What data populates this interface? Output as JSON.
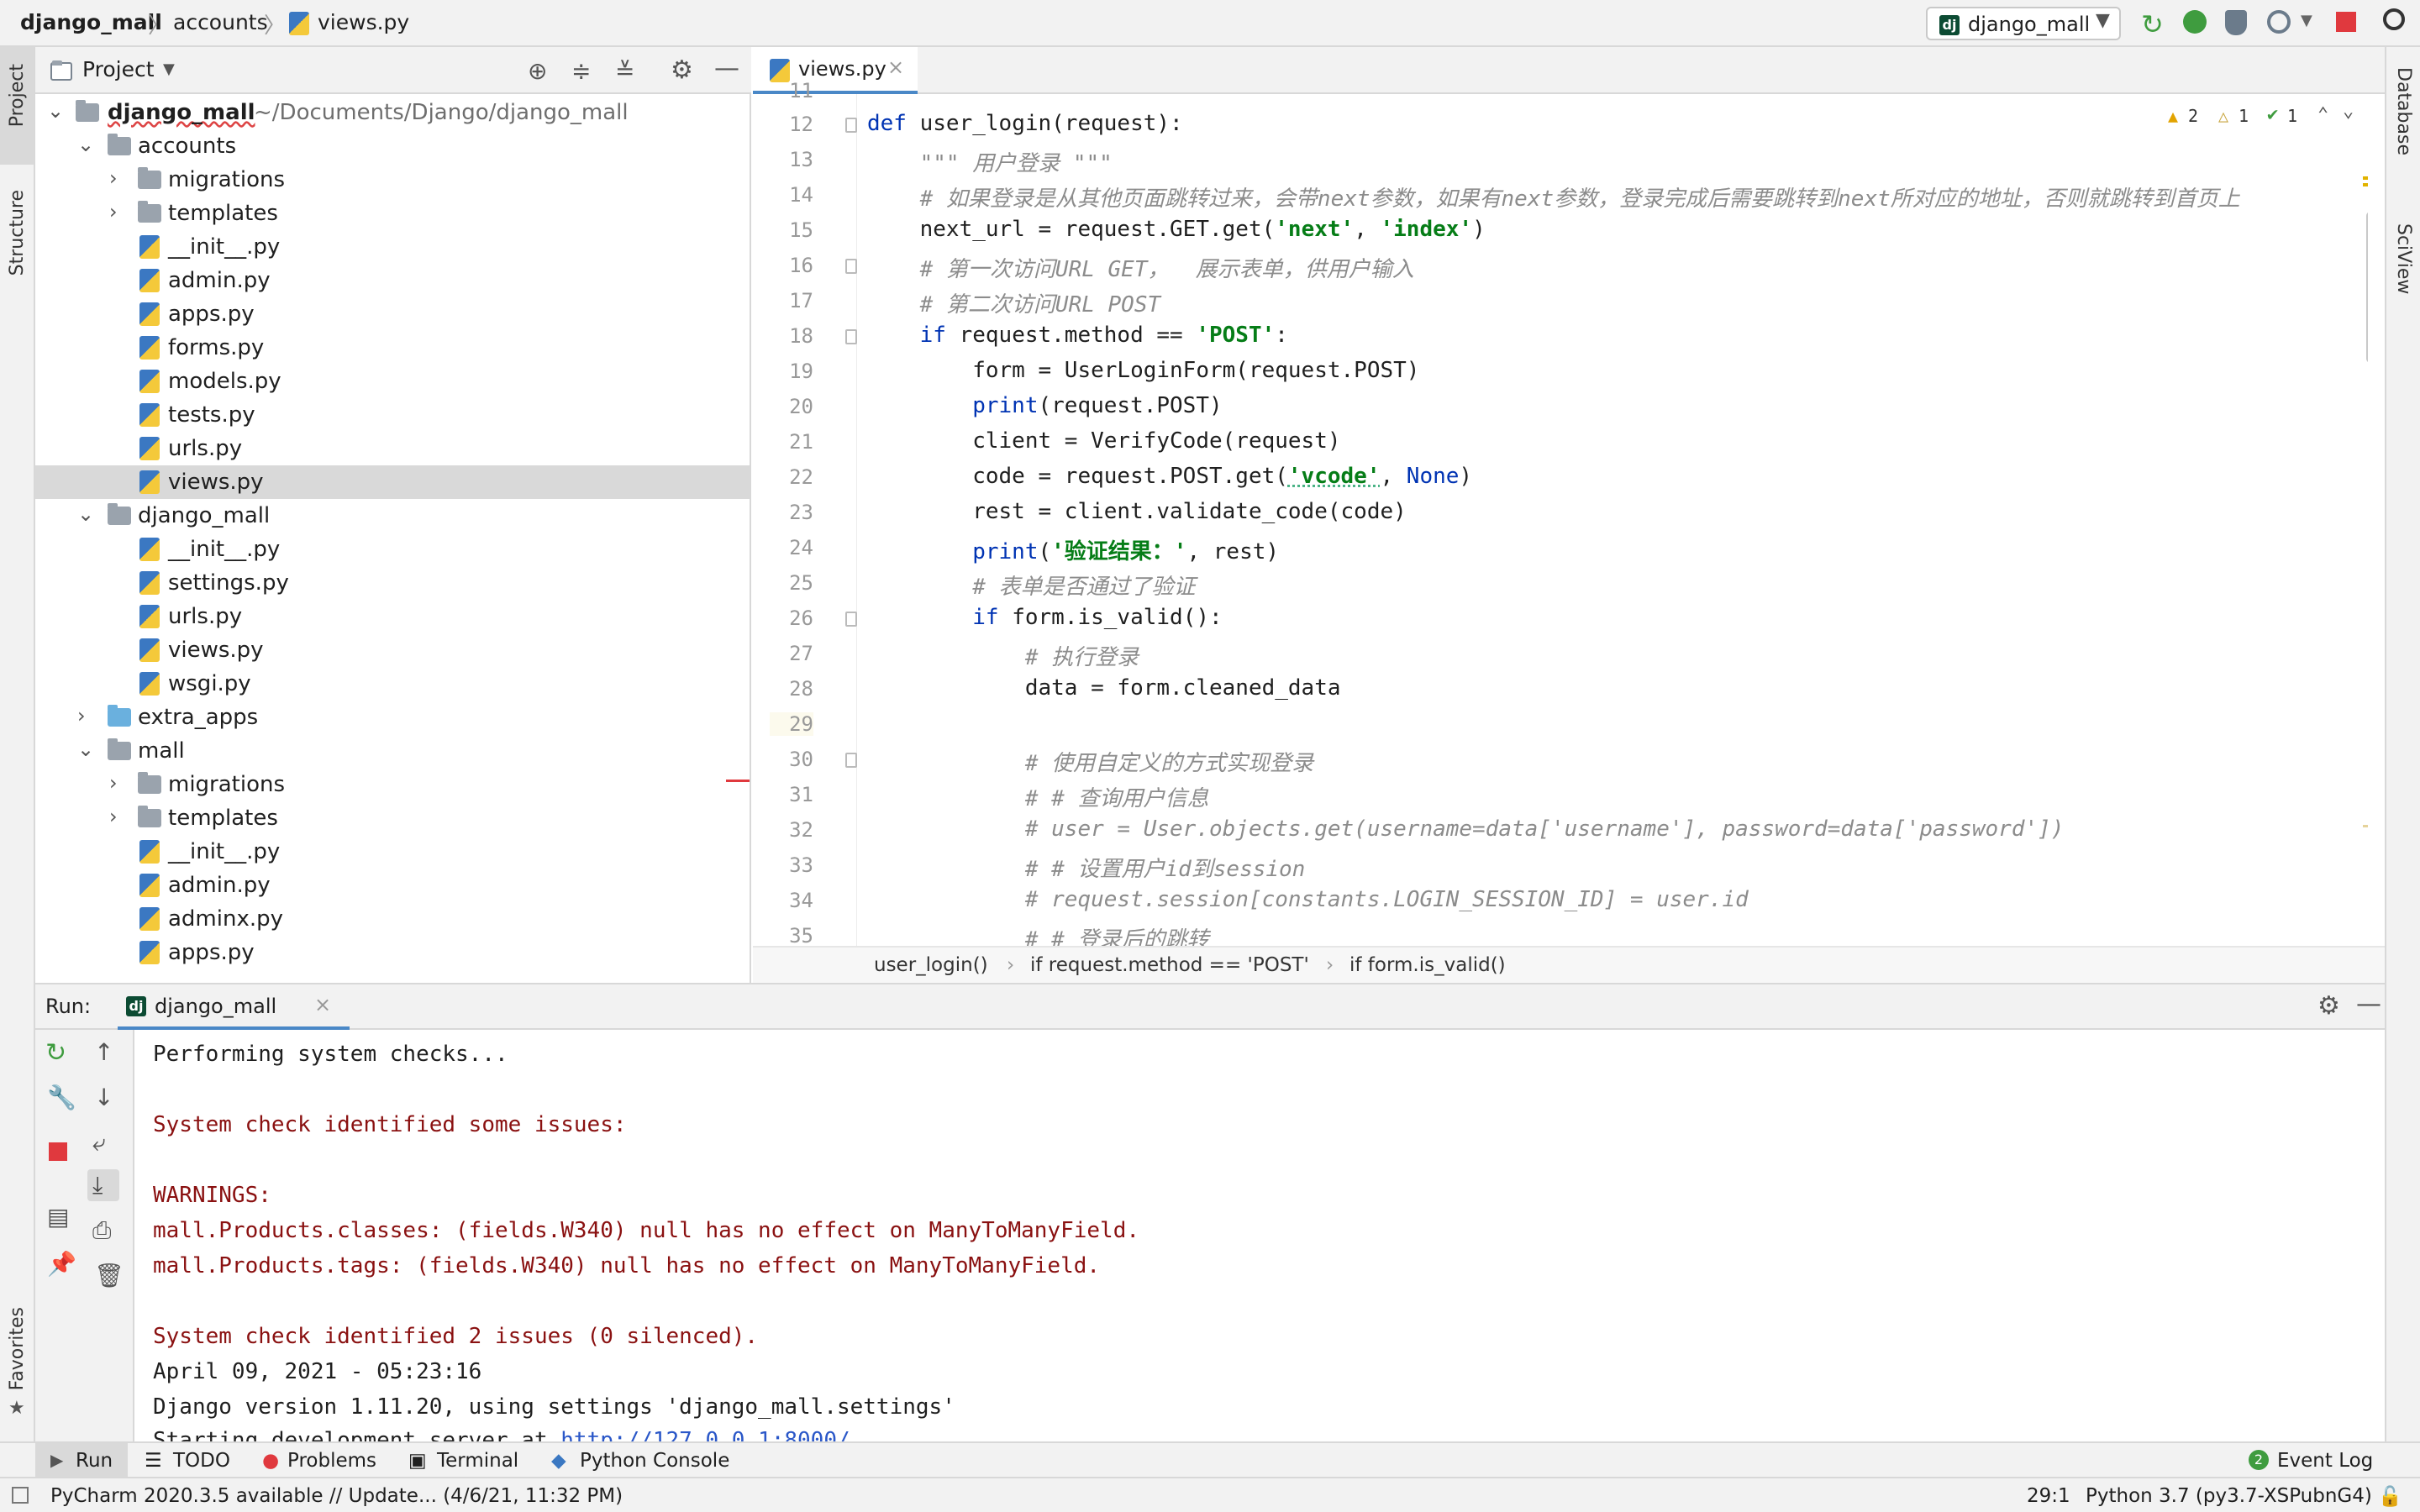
{
  "nav": {
    "project": "django_mall",
    "folder": "accounts",
    "file": "views.py"
  },
  "run_config": {
    "label": "django_mall"
  },
  "left_stripe": {
    "project": "Project",
    "structure": "Structure",
    "favorites": "Favorites"
  },
  "right_stripe": {
    "database": "Database",
    "sciview": "SciView"
  },
  "project_panel": {
    "title": "Project",
    "root": {
      "name": "django_mall",
      "path": "~/Documents/Django/django_mall"
    },
    "items": [
      {
        "label": "accounts"
      },
      {
        "label": "migrations"
      },
      {
        "label": "templates"
      },
      {
        "label": "__init__.py"
      },
      {
        "label": "admin.py"
      },
      {
        "label": "apps.py"
      },
      {
        "label": "forms.py"
      },
      {
        "label": "models.py"
      },
      {
        "label": "tests.py"
      },
      {
        "label": "urls.py"
      },
      {
        "label": "views.py"
      },
      {
        "label": "django_mall"
      },
      {
        "label": "__init__.py"
      },
      {
        "label": "settings.py"
      },
      {
        "label": "urls.py"
      },
      {
        "label": "views.py"
      },
      {
        "label": "wsgi.py"
      },
      {
        "label": "extra_apps"
      },
      {
        "label": "mall"
      },
      {
        "label": "migrations"
      },
      {
        "label": "templates"
      },
      {
        "label": "__init__.py"
      },
      {
        "label": "admin.py"
      },
      {
        "label": "adminx.py"
      },
      {
        "label": "apps.py"
      }
    ]
  },
  "editor": {
    "tab": "views.py",
    "inspections": {
      "warnings": "2",
      "weak_warnings": "1",
      "typos": "1"
    },
    "line_numbers": [
      "11",
      "12",
      "13",
      "14",
      "15",
      "16",
      "17",
      "18",
      "19",
      "20",
      "21",
      "22",
      "23",
      "24",
      "25",
      "26",
      "27",
      "28",
      "29",
      "30",
      "31",
      "32",
      "33",
      "34",
      "35"
    ],
    "lines": {
      "l12_def": "def",
      "l12_rest": " user_login(request):",
      "l13": "    \"\"\" 用户登录 \"\"\"",
      "l14": "    # 如果登录是从其他页面跳转过来，会带next参数，如果有next参数，登录完成后需要跳转到next所对应的地址，否则就跳转到首页上",
      "l15_a": "    next_url = request.GET.get(",
      "l15_s1": "'next'",
      "l15_b": ", ",
      "l15_s2": "'index'",
      "l15_c": ")",
      "l16": "    # 第一次访问URL GET，  展示表单，供用户输入",
      "l17": "    # 第二次访问URL POST",
      "l18_kw": "    if",
      "l18_a": " request.method == ",
      "l18_s": "'POST'",
      "l18_b": ":",
      "l19": "        form = UserLoginForm(request.POST)",
      "l20_bi": "        print",
      "l20_a": "(request.POST)",
      "l21": "        client = VerifyCode(request)",
      "l22_a": "        code = request.POST.get(",
      "l22_s": "'vcode'",
      "l22_b": ", ",
      "l22_kw": "None",
      "l22_c": ")",
      "l23": "        rest = client.validate_code(code)",
      "l24_bi": "        print",
      "l24_a": "(",
      "l24_s": "'验证结果：'",
      "l24_b": ", rest)",
      "l25": "        # 表单是否通过了验证",
      "l26_kw": "        if",
      "l26_a": " form.is_valid():",
      "l27": "            # 执行登录",
      "l28": "            data = form.cleaned_data",
      "l30": "            # 使用自定义的方式实现登录",
      "l31": "            # # 查询用户信息",
      "l32": "            # user = User.objects.get(username=data['username'], password=data['password'])",
      "l33": "            # # 设置用户id到session",
      "l34": "            # request.session[constants.LOGIN_SESSION_ID] = user.id",
      "l35": "            # # 登录后的跳转"
    },
    "breadcrumbs": [
      "user_login()",
      "if request.method == 'POST'",
      "if form.is_valid()"
    ]
  },
  "run_panel": {
    "label": "Run:",
    "tab": "django_mall",
    "console": [
      "Performing system checks...",
      "",
      "System check identified some issues:",
      "",
      "WARNINGS:",
      "mall.Products.classes: (fields.W340) null has no effect on ManyToManyField.",
      "mall.Products.tags: (fields.W340) null has no effect on ManyToManyField.",
      "",
      "System check identified 2 issues (0 silenced).",
      "April 09, 2021 - 05:23:16",
      "Django version 1.11.20, using settings 'django_mall.settings'"
    ],
    "console_partial_prefix": "Starting development server at ",
    "console_partial_link": "http://127.0.0.1:8000/"
  },
  "toolwindows": {
    "run": "Run",
    "todo": "TODO",
    "problems": "Problems",
    "terminal": "Terminal",
    "python_console": "Python Console",
    "event_log": "Event Log",
    "event_count": "2"
  },
  "status": {
    "message": "PyCharm 2020.3.5 available // Update... (4/6/21, 11:32 PM)",
    "position": "29:1",
    "interpreter": "Python 3.7 (py3.7-XSPubnG4)"
  },
  "colors": {
    "accent": "#4a88c7",
    "keyword": "#0033b3",
    "string": "#067d17",
    "comment": "#8c8c8c",
    "error": "#8a1111",
    "run_green": "#3f9c3f",
    "stop_red": "#e0393e"
  }
}
